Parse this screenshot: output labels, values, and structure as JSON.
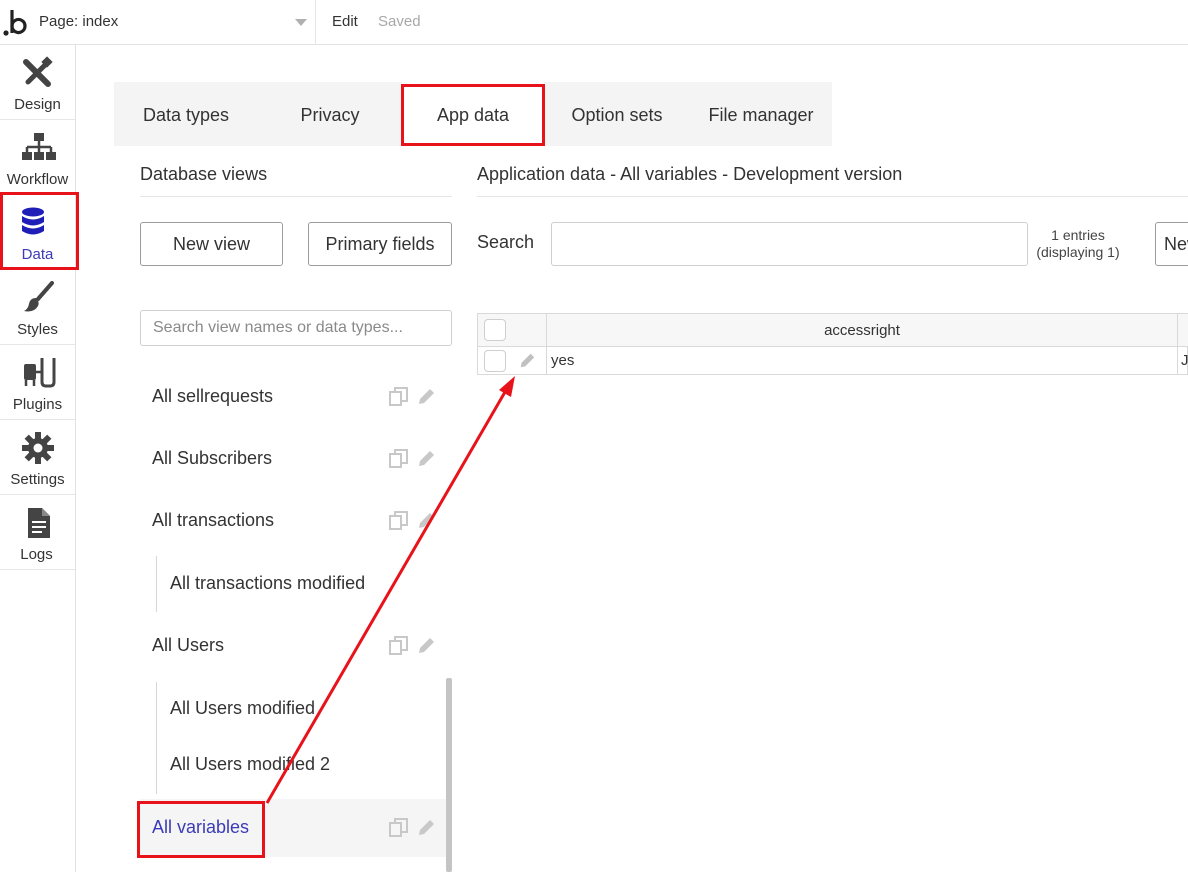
{
  "topbar": {
    "page_label": "Page: index",
    "edit_label": "Edit",
    "saved_label": "Saved"
  },
  "sidebar": {
    "items": [
      {
        "label": "Design",
        "icon": "design-icon"
      },
      {
        "label": "Workflow",
        "icon": "workflow-icon"
      },
      {
        "label": "Data",
        "icon": "database-icon",
        "active": true
      },
      {
        "label": "Styles",
        "icon": "brush-icon"
      },
      {
        "label": "Plugins",
        "icon": "plug-icon"
      },
      {
        "label": "Settings",
        "icon": "gear-icon"
      },
      {
        "label": "Logs",
        "icon": "document-icon"
      }
    ]
  },
  "tabs": [
    {
      "label": "Data types"
    },
    {
      "label": "Privacy"
    },
    {
      "label": "App data",
      "active": true
    },
    {
      "label": "Option sets"
    },
    {
      "label": "File manager"
    }
  ],
  "left_panel": {
    "title": "Database views",
    "new_view_label": "New view",
    "primary_fields_label": "Primary fields",
    "search_placeholder": "Search view names or data types...",
    "views": [
      {
        "label": "All sellrequests"
      },
      {
        "label": "All Subscribers"
      },
      {
        "label": "All transactions"
      },
      {
        "label": "All transactions modified"
      },
      {
        "label": "All Users"
      },
      {
        "label": "All Users modified"
      },
      {
        "label": "All Users modified 2"
      },
      {
        "label": "All variables",
        "selected": true
      }
    ]
  },
  "right_panel": {
    "title": "Application data - All variables - Development version",
    "search_label": "Search",
    "entries_line1": "1 entries",
    "entries_line2": "(displaying 1)",
    "new_button_label": "New",
    "table": {
      "columns": [
        "accessright"
      ],
      "rows": [
        {
          "accessright": "yes",
          "clipped_next": "Ja"
        }
      ]
    }
  },
  "colors": {
    "accent": "#3b3bb7",
    "annotation": "#e8131a"
  }
}
